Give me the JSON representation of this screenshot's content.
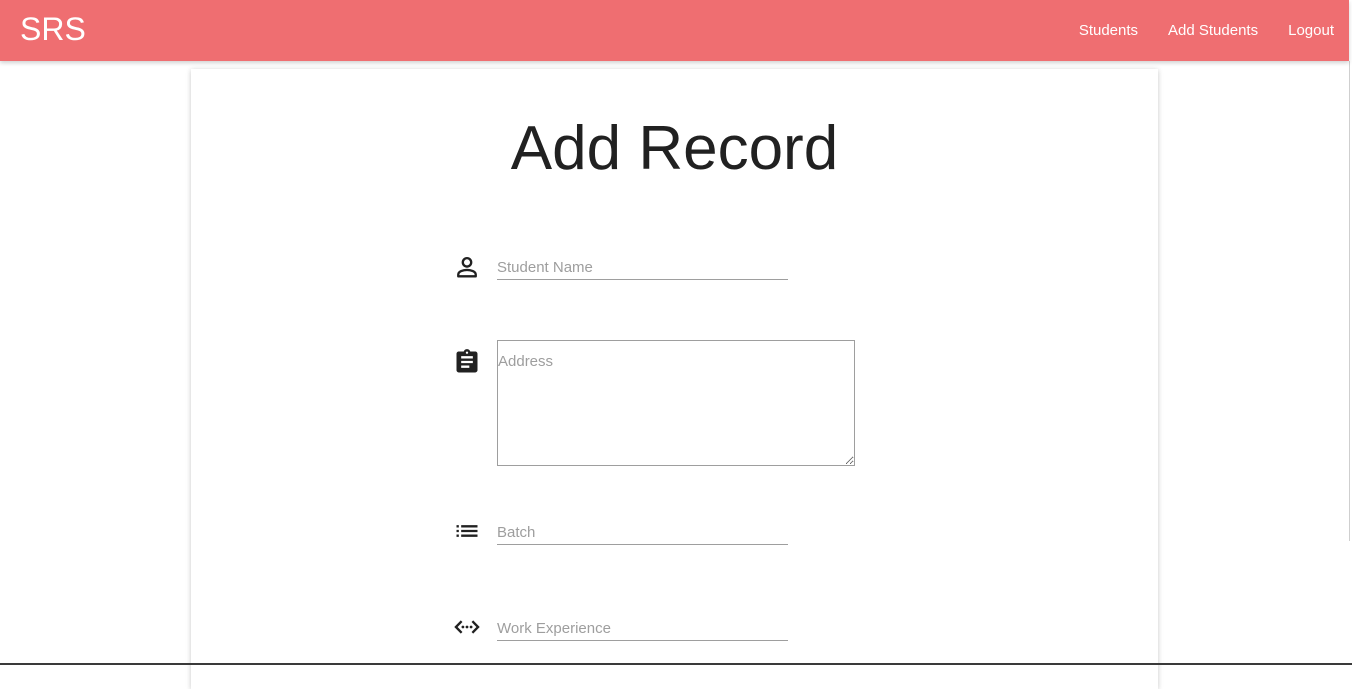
{
  "navbar": {
    "brand": "SRS",
    "links": [
      "Students",
      "Add Students",
      "Logout"
    ],
    "color": "#ef6e71"
  },
  "form": {
    "title": "Add Record",
    "fields": [
      {
        "icon": "person-icon",
        "placeholder": "Student Name",
        "value": ""
      },
      {
        "icon": "clipboard-icon",
        "placeholder": "Address",
        "value": ""
      },
      {
        "icon": "list-icon",
        "placeholder": "Batch",
        "value": ""
      },
      {
        "icon": "code-icon",
        "placeholder": "Work Experience",
        "value": ""
      }
    ]
  }
}
